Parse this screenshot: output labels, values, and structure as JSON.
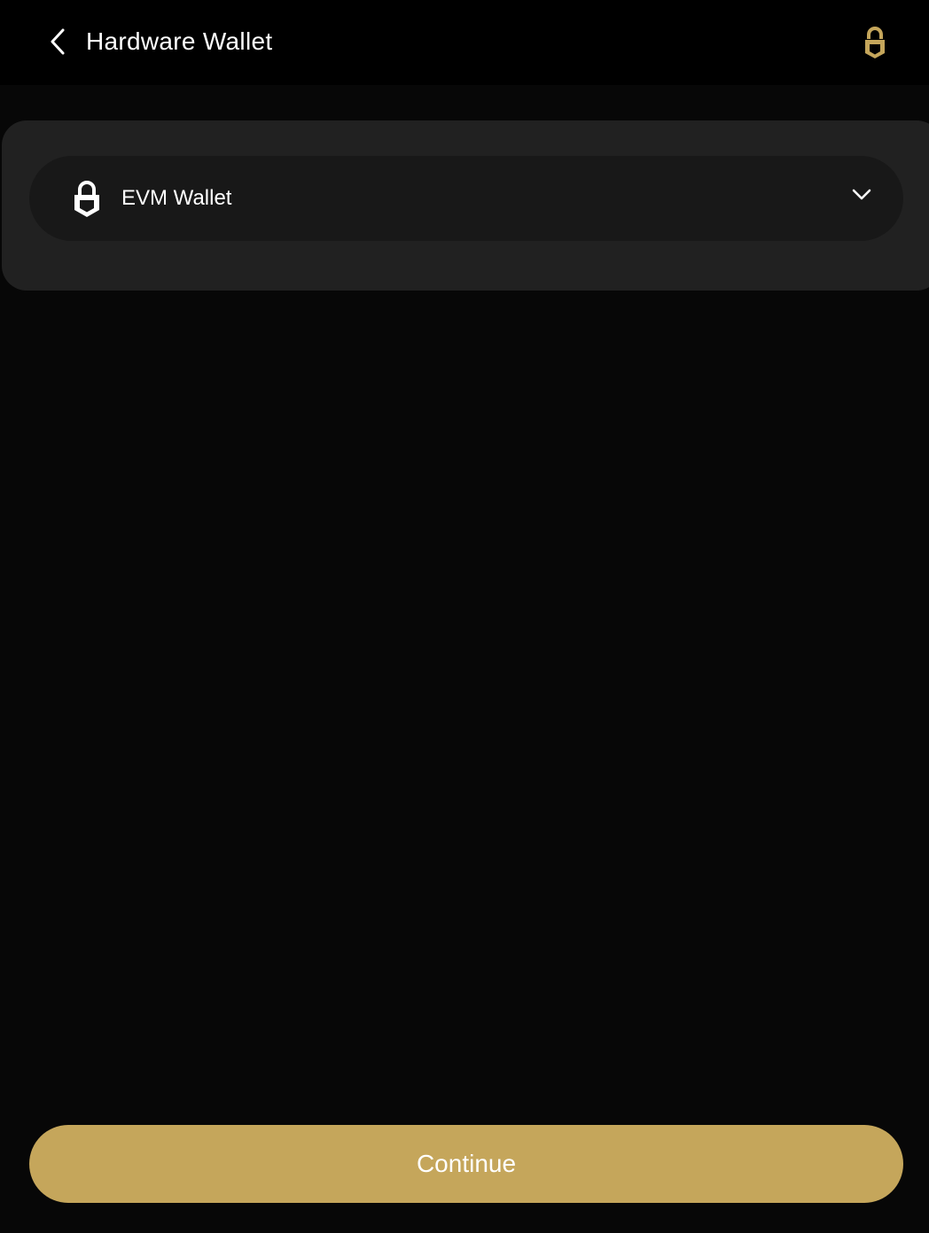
{
  "header": {
    "title": "Hardware Wallet",
    "back_icon": "chevron-left-icon",
    "lock_icon": "lock-icon"
  },
  "wallet_selector": {
    "icon": "wallet-lock-icon",
    "selected": "EVM Wallet",
    "chevron_icon": "chevron-down-icon"
  },
  "footer": {
    "continue_label": "Continue"
  },
  "colors": {
    "background": "#070707",
    "header_background": "#000000",
    "card": "#212121",
    "selector": "#181818",
    "accent_gold": "#c5a65b",
    "text": "#ffffff"
  }
}
